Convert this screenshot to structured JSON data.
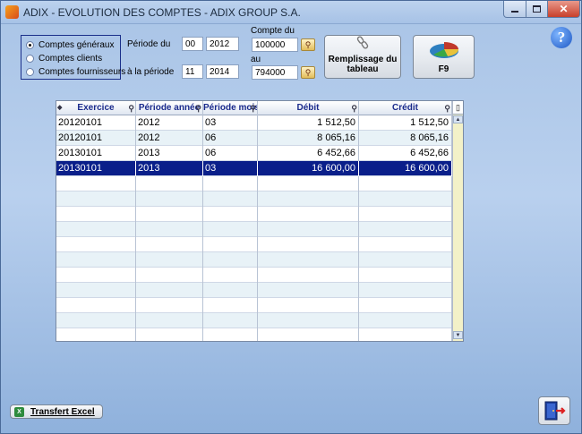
{
  "window": {
    "title": "ADIX - EVOLUTION DES COMPTES - ADIX GROUP S.A.",
    "min_label": "",
    "max_label": "",
    "close_label": "✕"
  },
  "account_type": {
    "options": [
      "Comptes généraux",
      "Comptes clients",
      "Comptes fournisseurs"
    ],
    "selected": "Comptes généraux"
  },
  "period": {
    "from_label": "Période du",
    "from_month": "00",
    "from_year": "2012",
    "to_label": "à la période",
    "to_month": "11",
    "to_year": "2014"
  },
  "account": {
    "from_label": "Compte du",
    "from_value": "100000",
    "to_label": "au",
    "to_value": "794000"
  },
  "buttons": {
    "fill_line1": "Remplissage du",
    "fill_line2": "tableau",
    "f9_label": "F9",
    "excel_label": "Transfert Excel"
  },
  "table": {
    "columns": [
      "Exercice",
      "Période année",
      "Période mois",
      "Débit",
      "Crédit"
    ],
    "rows": [
      [
        "20120101",
        "2012",
        "03",
        "1 512,50",
        "1 512,50"
      ],
      [
        "20120101",
        "2012",
        "06",
        "8 065,16",
        "8 065,16"
      ],
      [
        "20130101",
        "2013",
        "06",
        "6 452,66",
        "6 452,66"
      ],
      [
        "20130101",
        "2013",
        "03",
        "16 600,00",
        "16 600,00"
      ]
    ],
    "selected_row": 3
  },
  "icons": {
    "help": "help-icon",
    "exit": "exit-door-icon",
    "chart": "pie-chart-icon",
    "link": "link-icon"
  }
}
